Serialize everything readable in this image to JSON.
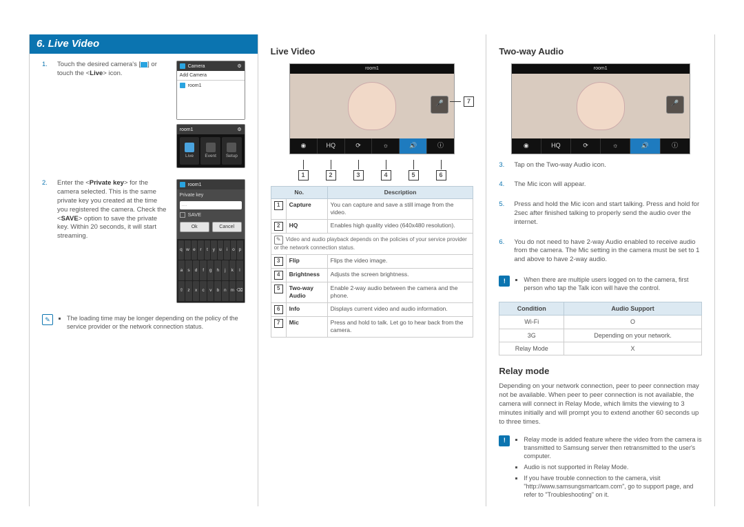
{
  "section_title": "6. Live Video",
  "col1": {
    "step1_num": "1.",
    "step1_text_a": "Touch the desired camera's [",
    "step1_text_b": "] or touch the <",
    "step1_live": "Live",
    "step1_text_c": "> icon.",
    "shot1": {
      "camera_label": "Camera",
      "add_camera": "Add Camera",
      "room": "room1"
    },
    "shot2": {
      "t1": "Live",
      "t2": "Event",
      "t3": "Setup"
    },
    "step2_num": "2.",
    "step2_a": "Enter the <",
    "step2_pk": "Private key",
    "step2_b": "> for the camera selected. This is the same private key you created at the time you registered the camera. Check the <",
    "step2_save": "SAVE",
    "step2_c": "> option to save the private key. Within 20 seconds, it will start streaming.",
    "kb": {
      "label": "Private key",
      "placeholder": "....",
      "save": "SAVE",
      "ok": "Ok",
      "cancel": "Cancel",
      "rows": [
        [
          "q",
          "w",
          "e",
          "r",
          "t",
          "y",
          "u",
          "i",
          "o",
          "p"
        ],
        [
          "a",
          "s",
          "d",
          "f",
          "g",
          "h",
          "j",
          "k",
          "l"
        ],
        [
          "⇧",
          "z",
          "x",
          "c",
          "v",
          "b",
          "n",
          "m",
          "⌫"
        ]
      ]
    },
    "note": "The loading time may be longer depending on the policy of the service provider or the network connection status."
  },
  "col2": {
    "heading": "Live Video",
    "room_label": "room1",
    "icons": [
      "◉",
      "HQ",
      "⟳",
      "☼",
      "🔊",
      "ⓘ"
    ],
    "callout7": "7",
    "callouts": [
      "1",
      "2",
      "3",
      "4",
      "5",
      "6"
    ],
    "table": {
      "h1": "No.",
      "h2": "",
      "h3": "Description",
      "rows": [
        {
          "n": "1",
          "name": "Capture",
          "desc": "You can capture and save a still image from the video."
        },
        {
          "n": "2",
          "name": "HQ",
          "desc": "Enables high quality video (640x480 resolution).",
          "desc2": "Video and audio playback depends on the policies of your service provider or the network connection status."
        },
        {
          "n": "3",
          "name": "Flip",
          "desc": "Flips the video image."
        },
        {
          "n": "4",
          "name": "Brightness",
          "desc": "Adjusts the screen brightness."
        },
        {
          "n": "5",
          "name": "Two-way Audio",
          "desc": "Enable 2-way audio between the camera and the phone."
        },
        {
          "n": "6",
          "name": "Info",
          "desc": "Displays current video and audio information."
        },
        {
          "n": "7",
          "name": "Mic",
          "desc": "Press and hold to talk. Let go to hear back from the camera."
        }
      ]
    }
  },
  "col3": {
    "heading1": "Two-way Audio",
    "room_label": "room1",
    "icons": [
      "◉",
      "HQ",
      "⟳",
      "☼",
      "🔊",
      "ⓘ"
    ],
    "steps": [
      {
        "n": "3.",
        "t": "Tap on the Two-way Audio icon."
      },
      {
        "n": "4.",
        "t": "The Mic icon will appear."
      },
      {
        "n": "5.",
        "t": "Press and hold the Mic icon and start talking. Press and hold for 2sec after finished talking to properly send the audio over the internet."
      },
      {
        "n": "6.",
        "t": "You do not need to have 2-way Audio enabled to receive audio from the camera. The Mic setting in the camera must be set to 1 and above to have 2-way audio."
      }
    ],
    "note1": "When there are multiple users logged on to the camera, first person who tap the Talk icon will have the control.",
    "support": {
      "h1": "Condition",
      "h2": "Audio Support",
      "rows": [
        {
          "c": "Wi-Fi",
          "s": "O"
        },
        {
          "c": "3G",
          "s": "Depending on your network."
        },
        {
          "c": "Relay Mode",
          "s": "X"
        }
      ]
    },
    "heading2": "Relay mode",
    "relay_para": "Depending on your network connection, peer to peer connection may not be available. When peer to peer connection is not available, the camera will connect in Relay Mode, which limits the viewing to 3 minutes initially and will prompt you to extend another 60 seconds up to three times.",
    "note2": [
      "Relay mode is added feature where the video from the camera is transmitted to Samsung server then retransmitted to the user's computer.",
      "Audio is not supported in Relay Mode.",
      "If you have trouble connection to the camera, visit \"http://www.samsungsmartcam.com\", go to support page, and refer to \"Troubleshooting\" on it."
    ]
  }
}
